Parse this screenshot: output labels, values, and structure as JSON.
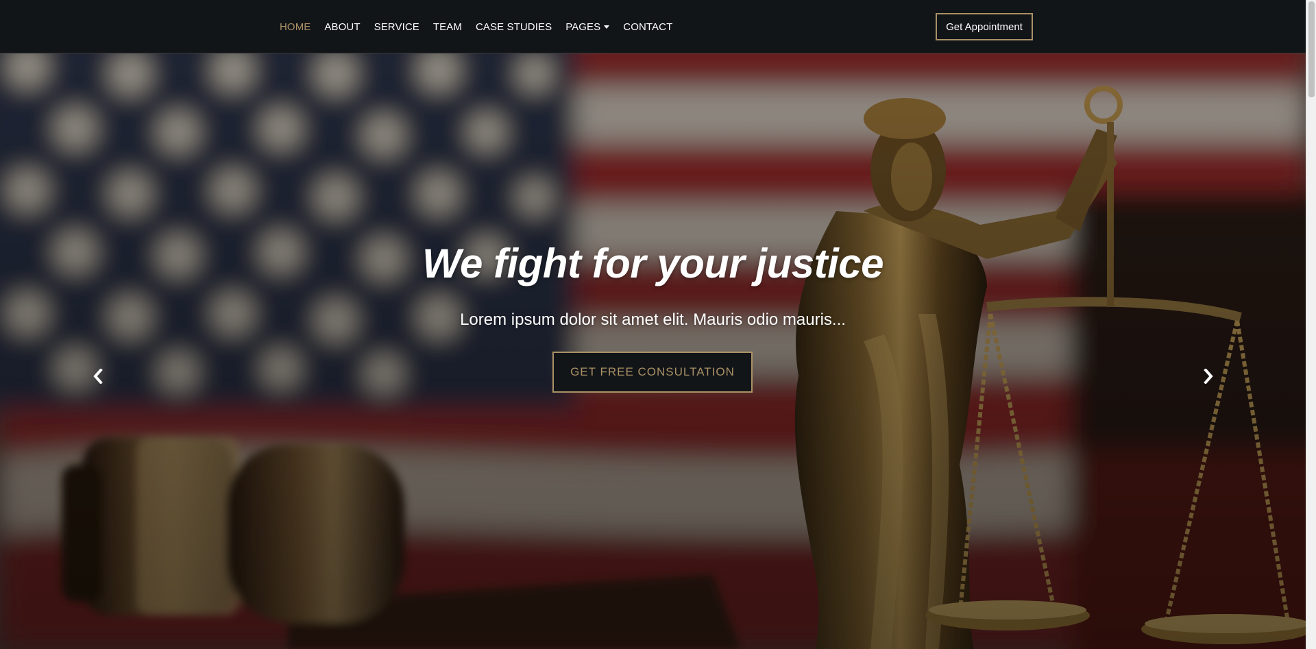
{
  "nav": {
    "items": [
      {
        "label": "HOME"
      },
      {
        "label": "ABOUT"
      },
      {
        "label": "SERVICE"
      },
      {
        "label": "TEAM"
      },
      {
        "label": "CASE STUDIES"
      },
      {
        "label": "PAGES"
      },
      {
        "label": "CONTACT"
      }
    ],
    "appointment_label": "Get Appointment"
  },
  "hero": {
    "title": "We fight for your justice",
    "subtitle": "Lorem ipsum dolor sit amet elit. Mauris odio mauris...",
    "cta_label": "GET FREE CONSULTATION",
    "prev_icon": "chevron-left-icon",
    "next_icon": "chevron-right-icon"
  },
  "colors": {
    "accent": "#aa9166",
    "navbar_bg": "#121518",
    "text_light": "#ffffff"
  }
}
